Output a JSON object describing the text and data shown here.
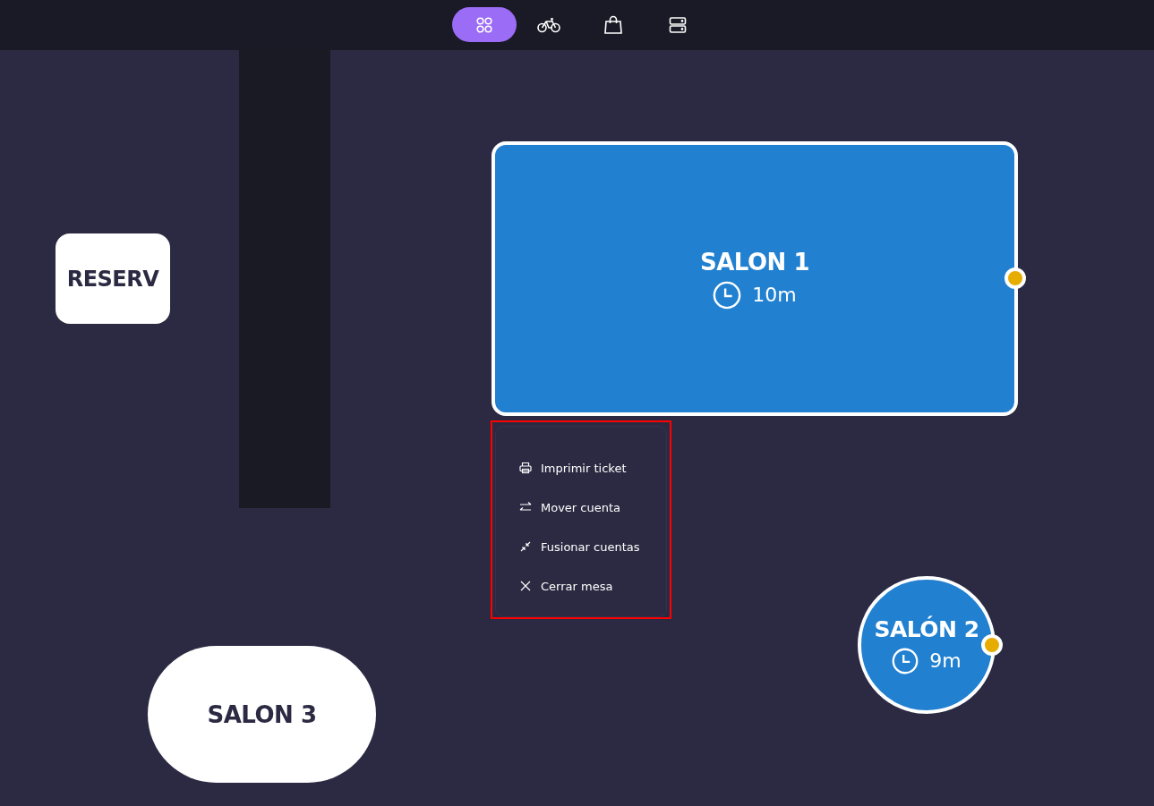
{
  "nav_tabs": [
    {
      "selected": true
    },
    {
      "selected": false
    },
    {
      "selected": false
    },
    {
      "selected": false
    }
  ],
  "tables": [
    {
      "kind": "square",
      "name": "RESERV",
      "occupied": false
    },
    {
      "kind": "rect",
      "name": "SALON 1",
      "occupied": true,
      "time": "10m",
      "color": "#e6ac00"
    },
    {
      "kind": "pill",
      "name": "SALON 3",
      "occupied": false
    },
    {
      "kind": "circle",
      "name": "SALÓN 2",
      "occupied": true,
      "time": "9m",
      "color": "#e6ac00"
    }
  ],
  "context_menu": {
    "items": [
      {
        "label": "Imprimir ticket"
      },
      {
        "label": "Mover cuenta"
      },
      {
        "label": "Fusionar cuentas"
      },
      {
        "label": "Cerrar mesa"
      }
    ]
  }
}
